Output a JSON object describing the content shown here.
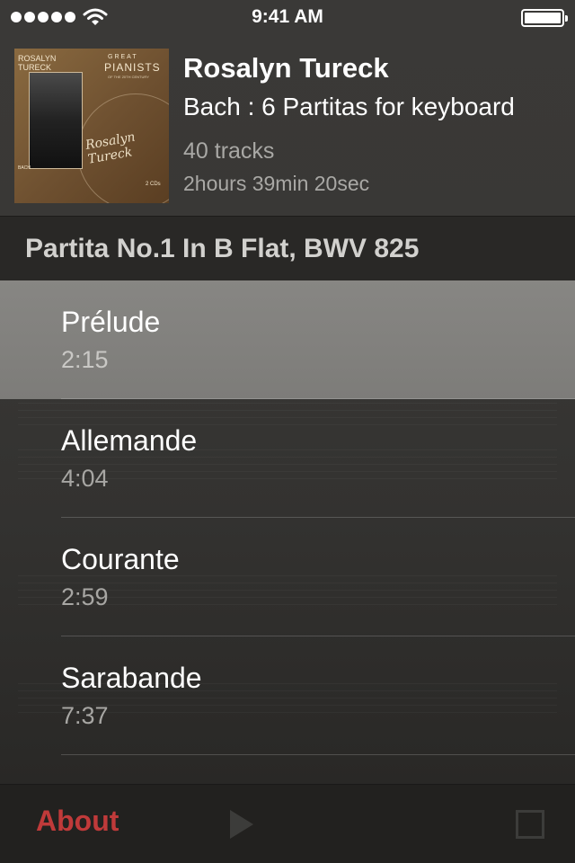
{
  "status_bar": {
    "time": "9:41 AM",
    "signal_icon": "signal-dots-icon",
    "wifi_icon": "wifi-icon",
    "battery_icon": "battery-icon",
    "battery_level": 1.0
  },
  "album": {
    "cover": {
      "name_line1": "ROSALYN",
      "name_line2": "TURECK",
      "series_a": "GREAT",
      "series_b": "PIANISTS",
      "series_c": "OF THE 20TH CENTURY",
      "composer": "BACH",
      "discs": "2 CDs",
      "signature": "Rosalyn Tureck"
    },
    "artist": "Rosalyn Tureck",
    "title": "Bach : 6 Partitas for keyboard",
    "track_count": "40 tracks",
    "duration": "2hours 39min 20sec"
  },
  "section": {
    "title": "Partita No.1 In B Flat, BWV 825"
  },
  "tracks": [
    {
      "name": "Prélude",
      "time": "2:15",
      "selected": true
    },
    {
      "name": "Allemande",
      "time": "4:04",
      "selected": false
    },
    {
      "name": "Courante",
      "time": "2:59",
      "selected": false
    },
    {
      "name": "Sarabande",
      "time": "7:37",
      "selected": false
    }
  ],
  "toolbar": {
    "about_label": "About",
    "about_color": "#c03a3a"
  }
}
